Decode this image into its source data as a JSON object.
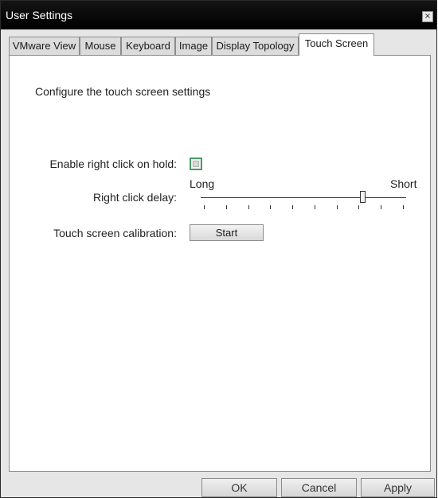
{
  "window": {
    "title": "User Settings",
    "close_glyph": "×"
  },
  "tabs": [
    {
      "label": "VMware View"
    },
    {
      "label": "Mouse"
    },
    {
      "label": "Keyboard"
    },
    {
      "label": "Image"
    },
    {
      "label": "Display Topology"
    },
    {
      "label": "Touch Screen",
      "active": true
    }
  ],
  "panel": {
    "description": "Configure the touch screen settings",
    "right_click": {
      "label": "Enable right click on hold:",
      "checked": false
    },
    "delay": {
      "label": "Right click delay:",
      "min_label": "Long",
      "max_label": "Short",
      "value_fraction": 0.8
    },
    "calibration": {
      "label": "Touch screen calibration:",
      "button": "Start"
    }
  },
  "footer": {
    "ok": "OK",
    "cancel": "Cancel",
    "apply": "Apply"
  }
}
